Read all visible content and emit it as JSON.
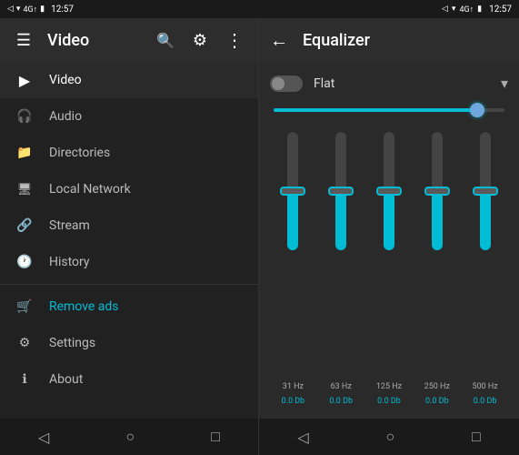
{
  "status_bar": {
    "left": {
      "time": "12:57",
      "signal_icon": "◁",
      "wifi_icon": "▼",
      "data_icon": "4G"
    },
    "right": {
      "time": "12:57",
      "battery_icon": "🔋",
      "signal": "4G"
    }
  },
  "left_panel": {
    "toolbar": {
      "menu_icon": "☰",
      "title": "Video",
      "search_icon": "🔍",
      "equalizer_icon": "⚙",
      "more_icon": "⋮"
    },
    "nav_items": [
      {
        "id": "video",
        "icon": "▶",
        "label": "Video",
        "active": true,
        "highlight": false
      },
      {
        "id": "audio",
        "icon": "🎧",
        "label": "Audio",
        "active": false,
        "highlight": false
      },
      {
        "id": "directories",
        "icon": "📁",
        "label": "Directories",
        "active": false,
        "highlight": false
      },
      {
        "id": "local-network",
        "icon": "🖥",
        "label": "Local Network",
        "active": false,
        "highlight": false
      },
      {
        "id": "stream",
        "icon": "🔗",
        "label": "Stream",
        "active": false,
        "highlight": false
      },
      {
        "id": "history",
        "icon": "🕐",
        "label": "History",
        "active": false,
        "highlight": false
      },
      {
        "id": "remove-ads",
        "icon": "🛒",
        "label": "Remove ads",
        "active": false,
        "highlight": true
      },
      {
        "id": "settings",
        "icon": "⚙",
        "label": "Settings",
        "active": false,
        "highlight": false
      },
      {
        "id": "about",
        "icon": "ℹ",
        "label": "About",
        "active": false,
        "highlight": false
      }
    ],
    "bottom_nav": {
      "back": "◁",
      "home": "○",
      "recent": "□"
    }
  },
  "right_panel": {
    "toolbar": {
      "back_icon": "←",
      "title": "Equalizer"
    },
    "preset": {
      "toggle_enabled": false,
      "label": "Flat",
      "dropdown_icon": "▾"
    },
    "master_slider": {
      "value": 88
    },
    "bands": [
      {
        "id": "band-31hz",
        "freq": "31 Hz",
        "value": "0.0 Db",
        "fill_pct": 50
      },
      {
        "id": "band-63hz",
        "freq": "63 Hz",
        "value": "0.0 Db",
        "fill_pct": 50
      },
      {
        "id": "band-125hz",
        "freq": "125 Hz",
        "value": "0.0 Db",
        "fill_pct": 50
      },
      {
        "id": "band-250hz",
        "freq": "250 Hz",
        "value": "0.0 Db",
        "fill_pct": 50
      },
      {
        "id": "band-500hz",
        "freq": "500 Hz",
        "value": "0.0 Db",
        "fill_pct": 50
      }
    ],
    "bottom_nav": {
      "back": "◁",
      "home": "○",
      "recent": "□"
    }
  },
  "colors": {
    "accent": "#00bcd4",
    "active_bg": "#2a2a2a",
    "toolbar_bg": "#2d2d2d",
    "panel_bg": "#212121",
    "highlight": "#00bcd4"
  }
}
